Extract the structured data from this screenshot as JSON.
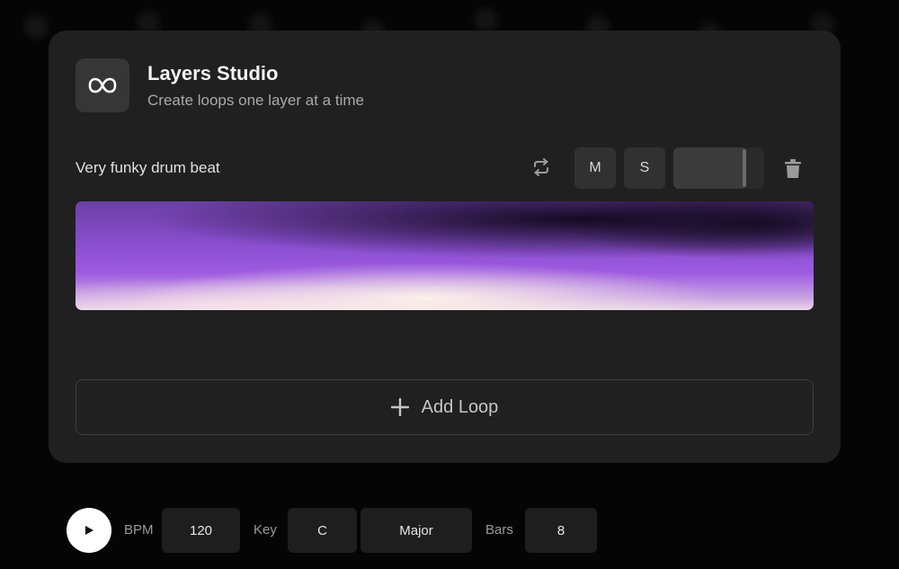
{
  "app": {
    "title": "Layers Studio",
    "subtitle": "Create loops one layer at a time",
    "icon": "infinity-icon"
  },
  "layer": {
    "name": "Very funky drum beat",
    "loop_icon": "loop-repeat-icon",
    "mute_label": "M",
    "solo_label": "S",
    "volume_level": 0.78,
    "delete_icon": "trash-icon",
    "waveform_overlay": "···",
    "waveform_colors": [
      "#8a4fd0",
      "#1a0f26",
      "#f3e6dc"
    ]
  },
  "add_loop": {
    "label": "Add Loop",
    "icon": "plus-icon"
  },
  "transport": {
    "play_icon": "play-icon",
    "bpm_label": "BPM",
    "bpm_value": "120",
    "key_label": "Key",
    "key_value": "C",
    "scale_value": "Major",
    "bars_label": "Bars",
    "bars_value": "8"
  },
  "colors": {
    "background": "#050505",
    "panel": "#202020",
    "button": "#313131",
    "accent_purple": "#9d5ae0"
  }
}
